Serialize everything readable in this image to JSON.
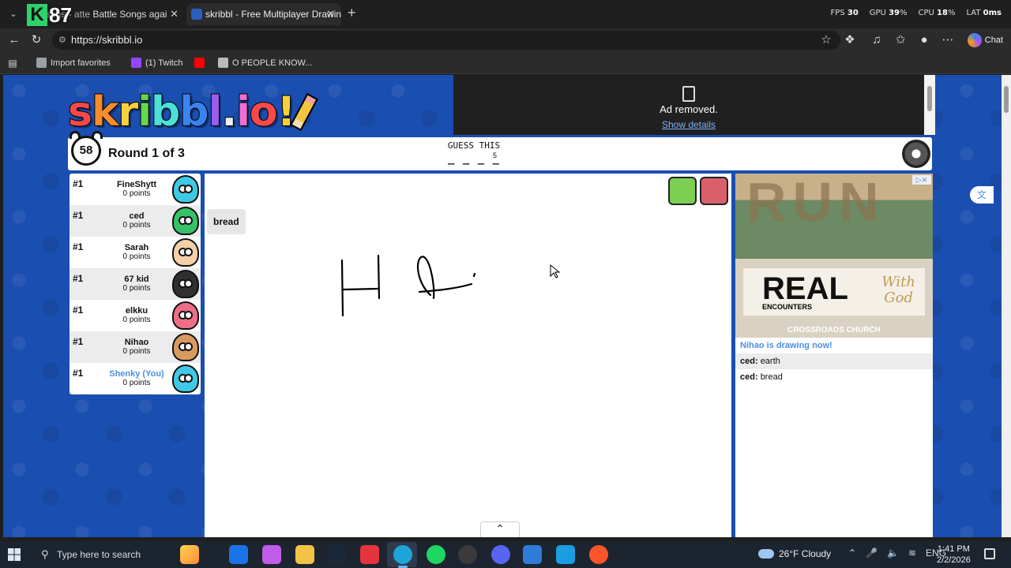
{
  "browser": {
    "overlay_logo": {
      "letter": "K",
      "number": "87"
    },
    "tabs": [
      {
        "title": "Battle Songs agai",
        "title_prefix": "sons - atte",
        "active": false
      },
      {
        "title": "skribbl - Free Multiplayer Drawing",
        "active": true
      }
    ],
    "new_tab": "+",
    "perf": {
      "fps_label": "FPS",
      "fps": "30",
      "gpu_label": "GPU",
      "gpu": "39",
      "cpu_label": "CPU",
      "cpu": "18",
      "lat_label": "LAT",
      "lat": "0ms",
      "pct": "%"
    },
    "url": "https://skribbl.io",
    "chat_label": "Chat",
    "favorites": [
      {
        "label": "Import favorites",
        "color": "#9aa0a6"
      },
      {
        "label": "(1) Twitch",
        "color": "#9146ff"
      },
      {
        "label": "",
        "color": "#ff0000"
      },
      {
        "label": "O PEOPLE KNOW...",
        "color": "#bbbbbb"
      }
    ]
  },
  "game": {
    "logo_letters": [
      {
        "ch": "s",
        "color": "#f84949"
      },
      {
        "ch": "k",
        "color": "#f88b2b"
      },
      {
        "ch": "r",
        "color": "#f8d13a"
      },
      {
        "ch": "i",
        "color": "#67d84b"
      },
      {
        "ch": "b",
        "color": "#4ce0d6"
      },
      {
        "ch": "b",
        "color": "#3c83f0"
      },
      {
        "ch": "l",
        "color": "#9d5bf0"
      },
      {
        "ch": ".",
        "color": "#f0f0f0"
      },
      {
        "ch": "i",
        "color": "#f06fd1"
      },
      {
        "ch": "o",
        "color": "#f84949"
      },
      {
        "ch": "!",
        "color": "#f8d13a"
      }
    ],
    "ad_top": {
      "removed": "Ad removed.",
      "details": "Show details"
    },
    "timer": "58",
    "round_text": "Round 1 of 3",
    "guess_label": "GUESS THIS",
    "word_blanks": "_ _ _ _ _",
    "word_length": "5",
    "players": [
      {
        "rank": "#1",
        "name": "FineShytt",
        "points": "0 points",
        "avatar_color": "#3ec9e6",
        "you": false
      },
      {
        "rank": "#1",
        "name": "ced",
        "points": "0 points",
        "avatar_color": "#36c16a",
        "you": false
      },
      {
        "rank": "#1",
        "name": "Sarah",
        "points": "0 points",
        "avatar_color": "#f3d0a8",
        "you": false
      },
      {
        "rank": "#1",
        "name": "67 kid",
        "points": "0 points",
        "avatar_color": "#2f2f2f",
        "you": false
      },
      {
        "rank": "#1",
        "name": "elkku",
        "points": "0 points",
        "avatar_color": "#ef6e86",
        "you": false
      },
      {
        "rank": "#1",
        "name": "Nihao",
        "points": "0 points",
        "avatar_color": "#d99a62",
        "you": false
      },
      {
        "rank": "#1",
        "name": "Shenky (You)",
        "points": "0 points",
        "avatar_color": "#3ec9e6",
        "you": true
      }
    ],
    "bubble": "bread",
    "right_ad": {
      "big_text": "RUN",
      "real": "REAL",
      "encounters": "ENCOUNTERS",
      "with_god_1": "With",
      "with_god_2": "God",
      "church": "CROSSROADS CHURCH"
    },
    "chat": [
      {
        "type": "system",
        "text": "Nihao is drawing now!"
      },
      {
        "type": "message",
        "user": "ced:",
        "text": "earth"
      },
      {
        "type": "message",
        "user": "ced:",
        "text": "bread"
      }
    ]
  },
  "taskbar": {
    "search_placeholder": "Type here to search",
    "apps": [
      {
        "name": "microsoft-store",
        "color": "#1a73e8"
      },
      {
        "name": "copilot",
        "color": "#c05ce8"
      },
      {
        "name": "file-explorer",
        "color": "#f3c347"
      },
      {
        "name": "steam",
        "color": "#1b2838"
      },
      {
        "name": "wps-office",
        "color": "#e4353c"
      },
      {
        "name": "edge",
        "color": "#1da4d8"
      },
      {
        "name": "spotify",
        "color": "#1ed760"
      },
      {
        "name": "obs",
        "color": "#3a3a3a"
      },
      {
        "name": "discord",
        "color": "#5865f2"
      },
      {
        "name": "notepad",
        "color": "#2f7cd8"
      },
      {
        "name": "files",
        "color": "#1b9de2"
      },
      {
        "name": "brave",
        "color": "#fb542b"
      }
    ],
    "weather": "26°F Cloudy",
    "lang": "ENG",
    "time": "1:41 PM",
    "date": "2/2/2026"
  }
}
